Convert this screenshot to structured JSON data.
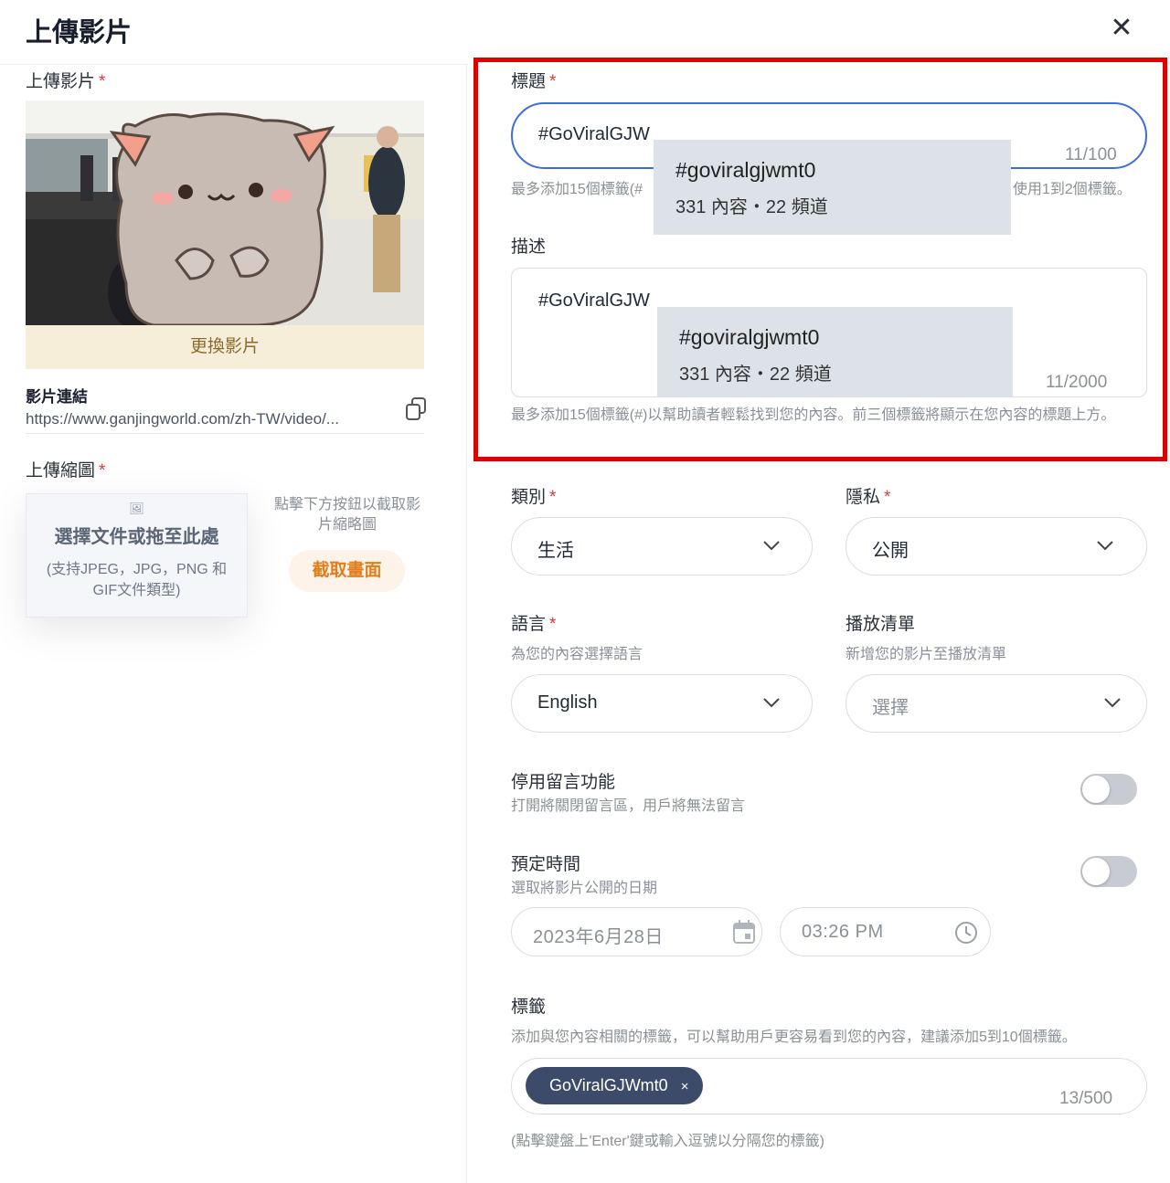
{
  "header": {
    "title": "上傳影片",
    "close_icon": "close-icon"
  },
  "left": {
    "video_label": "上傳影片",
    "replace_video": "更換影片",
    "link_label": "影片連結",
    "link_url": "https://www.ganjingworld.com/zh-TW/video/...",
    "thumbnail_label": "上傳縮圖",
    "dropzone_icon": "image-upload-icon",
    "dropzone_title": "選擇文件或拖至此處",
    "dropzone_hint": "(支持JPEG，JPG，PNG 和 GIF文件類型)",
    "capture_hint": "點擊下方按鈕以截取影片縮略圖",
    "capture_button": "截取畫面"
  },
  "form": {
    "title_label": "標題",
    "title_value": "#GoViralGJW",
    "title_counter": "11/100",
    "title_helper_left": "最多添加15個標籤(#",
    "title_helper_right": "使用1到2個標籤。",
    "title_suggestion": {
      "tag": "#goviralgjwmt0",
      "meta": "331 內容・22 頻道"
    },
    "desc_label": "描述",
    "desc_value": "#GoViralGJW",
    "desc_counter": "11/2000",
    "desc_suggestion": {
      "tag": "#goviralgjwmt0",
      "meta": "331 內容・22 頻道"
    },
    "desc_helper": "最多添加15個標籤(#)以幫助讀者輕鬆找到您的內容。前三個標籤將顯示在您內容的標題上方。",
    "category_label": "類別",
    "category_value": "生活",
    "privacy_label": "隱私",
    "privacy_value": "公開",
    "language_label": "語言",
    "language_sub": "為您的內容選擇語言",
    "language_value": "English",
    "playlist_label": "播放清單",
    "playlist_sub": "新增您的影片至播放清單",
    "playlist_placeholder": "選擇",
    "disable_comments_label": "停用留言功能",
    "disable_comments_sub": "打開將關閉留言區，用戶將無法留言",
    "disable_comments_on": false,
    "schedule_label": "預定時間",
    "schedule_sub": "選取將影片公開的日期",
    "schedule_on": false,
    "schedule_date": "2023年6月28日",
    "schedule_time": "03:26 PM",
    "tags_label": "標籤",
    "tags_sub": "添加與您內容相關的標籤，可以幫助用戶更容易看到您的內容，建議添加5到10個標籤。",
    "tags": [
      "GoViralGJWmt0"
    ],
    "tags_counter": "13/500",
    "tags_hint": "(點擊鍵盤上'Enter'鍵或輸入逗號以分隔您的標籤)"
  }
}
